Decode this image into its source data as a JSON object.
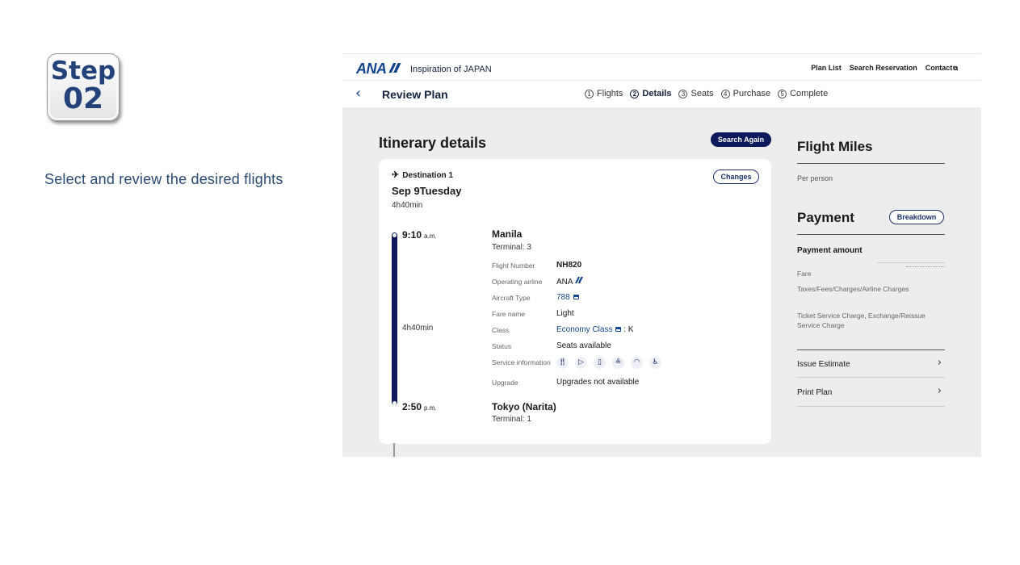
{
  "step": {
    "word": "Step",
    "number": "02",
    "caption": "Select and review the desired flights"
  },
  "header": {
    "logo": "ANA",
    "tagline": "Inspiration of JAPAN",
    "nav": [
      "Plan List",
      "Search Reservation",
      "Contact"
    ]
  },
  "subheader": {
    "title": "Review Plan",
    "steps": [
      {
        "num": "1",
        "label": "Flights"
      },
      {
        "num": "2",
        "label": "Details"
      },
      {
        "num": "3",
        "label": "Seats"
      },
      {
        "num": "4",
        "label": "Purchase"
      },
      {
        "num": "5",
        "label": "Complete"
      }
    ],
    "active_step": 2
  },
  "itinerary": {
    "title": "Itinerary details",
    "search_again": "Search Again",
    "destination": "Destination 1",
    "changes": "Changes",
    "date": "Sep 9Tuesday",
    "duration": "4h40min",
    "departure": {
      "time": "9:10",
      "ampm": "a.m.",
      "city": "Manila",
      "terminal": "Terminal: 3"
    },
    "arrival": {
      "time": "2:50",
      "ampm": "p.m.",
      "city": "Tokyo (Narita)",
      "terminal": "Terminal: 1"
    },
    "mid_duration": "4h40min",
    "details": {
      "flight_number": {
        "label": "Flight Number",
        "value": "NH820"
      },
      "operating_airline": {
        "label": "Operating airline",
        "value": "ANA"
      },
      "aircraft_type": {
        "label": "Aircraft Type",
        "value": "788"
      },
      "fare_name": {
        "label": "Fare name",
        "value": "Light"
      },
      "class": {
        "label": "Class",
        "value": "Economy Class",
        "suffix": ": K"
      },
      "status": {
        "label": "Status",
        "value": "Seats available"
      },
      "service_information": {
        "label": "Service information",
        "icons": [
          "meal-icon",
          "entertainment-icon",
          "baggage-icon",
          "lounge-icon",
          "wifi-icon",
          "accessibility-icon"
        ]
      },
      "upgrade": {
        "label": "Upgrade",
        "value": "Upgrades not available"
      }
    }
  },
  "right_panel": {
    "flight_miles_title": "Flight Miles",
    "per_person": "Per person",
    "payment_title": "Payment",
    "breakdown": "Breakdown",
    "payment_amount": "Payment amount",
    "fare": "Fare",
    "taxes": "Taxes/Fees/Charges/Airline Charges",
    "ticket_service": "Ticket Service Charge, Exchange/Reissue Service Charge",
    "issue_estimate": "Issue Estimate",
    "print_plan": "Print Plan"
  },
  "colors": {
    "brand_navy": "#0c1a5c",
    "ana_blue": "#13448f",
    "panel_bg": "#ededed",
    "caption": "#2a4a74"
  }
}
